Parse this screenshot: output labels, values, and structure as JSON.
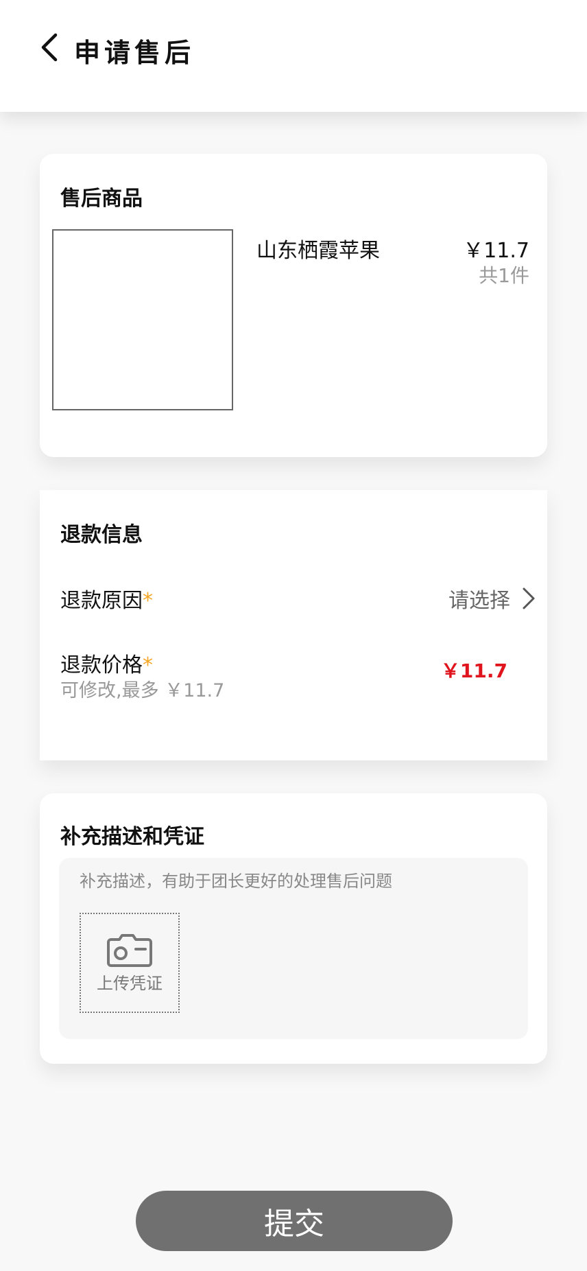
{
  "header": {
    "title": "申请售后",
    "back_icon": "chevron-left-icon"
  },
  "goods": {
    "section_title": "售后商品",
    "name": "山东栖霞苹果",
    "price": "￥11.7",
    "count": "共1件"
  },
  "refund": {
    "section_title": "退款信息",
    "reason_label": "退款原因",
    "reason_required": "*",
    "reason_value": "请选择",
    "price_label": "退款价格",
    "price_required": "*",
    "price_hint": "可修改,最多 ￥11.7",
    "price_value": "￥11.7"
  },
  "description": {
    "section_title": "补充描述和凭证",
    "placeholder": "补充描述，有助于团长更好的处理售后问题",
    "upload_label": "上传凭证",
    "upload_icon": "camera-icon"
  },
  "submit_label": "提交",
  "colors": {
    "accent_red": "#e0141c",
    "required_orange": "#f5a623",
    "submit_gray": "#707070"
  }
}
